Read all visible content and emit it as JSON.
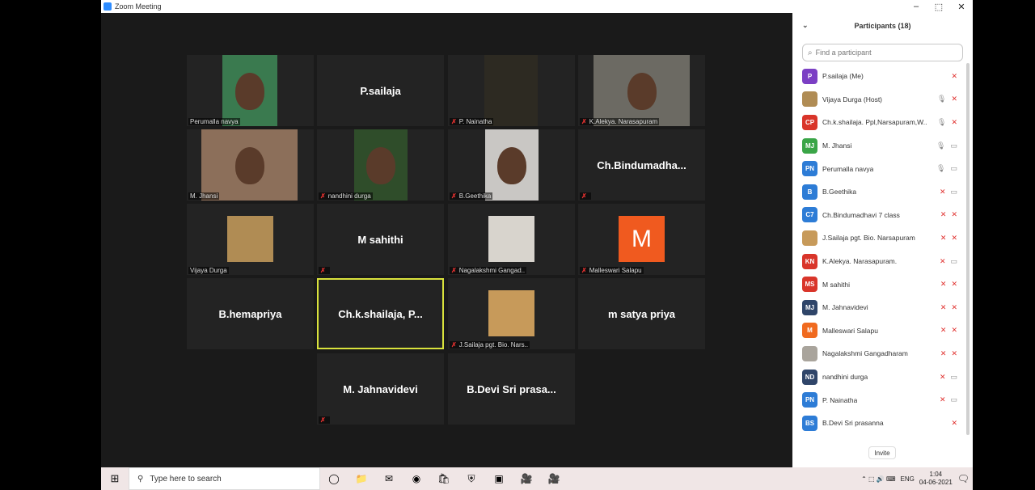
{
  "window": {
    "title": "Zoom Meeting",
    "controls": [
      "–",
      "⬚",
      "✕"
    ]
  },
  "tiles": [
    {
      "id": "t1",
      "label": "Perumalla navya",
      "mic_muted": false,
      "video": true,
      "video_color": "#3a7a4f",
      "name_shown": ""
    },
    {
      "id": "t2",
      "label": "",
      "mic_muted": false,
      "video": false,
      "name_shown": "P.sailaja"
    },
    {
      "id": "t3",
      "label": "P. Nainatha",
      "mic_muted": true,
      "video": true,
      "video_color": "#2d2a22",
      "name_shown": ""
    },
    {
      "id": "t4",
      "label": "K.Alekya. Narasapuram",
      "mic_muted": true,
      "video": true,
      "video_color": "#6c6a63",
      "name_shown": ""
    },
    {
      "id": "t5",
      "label": "M. Jhansi",
      "mic_muted": false,
      "video": true,
      "video_color": "#8c6f5a",
      "name_shown": ""
    },
    {
      "id": "t6",
      "label": "nandhini durga",
      "mic_muted": true,
      "video": true,
      "video_color": "#2f4d2a",
      "name_shown": ""
    },
    {
      "id": "t7",
      "label": "B.Geethika",
      "mic_muted": true,
      "video": true,
      "video_color": "#c9c7c4",
      "name_shown": ""
    },
    {
      "id": "t8",
      "label": "",
      "mic_muted": true,
      "video": false,
      "name_shown": "Ch.Bindumadha..."
    },
    {
      "id": "t9",
      "label": "Vijaya Durga",
      "mic_muted": false,
      "video": true,
      "video_color": "#b08c54",
      "name_shown": ""
    },
    {
      "id": "t10",
      "label": "",
      "mic_muted": true,
      "video": false,
      "name_shown": "M sahithi"
    },
    {
      "id": "t11",
      "label": "Nagalakshmi Gangad..",
      "mic_muted": true,
      "video": true,
      "video_color": "#d8d4cd",
      "name_shown": ""
    },
    {
      "id": "t12",
      "label": "Malleswari Salapu",
      "mic_muted": true,
      "video": false,
      "avatar_letter": "M",
      "name_shown": ""
    },
    {
      "id": "t13",
      "label": "",
      "mic_muted": false,
      "video": false,
      "name_shown": "B.hemapriya"
    },
    {
      "id": "t14",
      "label": "",
      "mic_muted": false,
      "video": false,
      "name_shown": "Ch.k.shailaja,  P...",
      "active": true
    },
    {
      "id": "t15",
      "label": "J.Sailaja pgt. Bio. Nars..",
      "mic_muted": true,
      "video": true,
      "video_color": "#c79a5a",
      "name_shown": ""
    },
    {
      "id": "t16",
      "label": "",
      "mic_muted": false,
      "video": false,
      "name_shown": "m satya priya"
    },
    {
      "id": "t17",
      "label": "",
      "mic_muted": true,
      "video": false,
      "name_shown": "M. Jahnavidevi"
    },
    {
      "id": "t18",
      "label": "",
      "mic_muted": false,
      "video": false,
      "name_shown": "B.Devi Sri   prasa..."
    }
  ],
  "sidebar": {
    "title": "Participants (18)",
    "search_placeholder": "Find a participant",
    "invite_label": "Invite",
    "participants": [
      {
        "initials": "P",
        "color": "#7b3fc4",
        "name": "P.sailaja (Me)",
        "mic": "",
        "cam": "✕",
        "cam_off": true
      },
      {
        "initials": "",
        "color": "#b08c54",
        "name": "Vijaya Durga (Host)",
        "mic": "🎙",
        "cam": "✕",
        "cam_off": true,
        "mic_muted": false
      },
      {
        "initials": "CP",
        "color": "#d9352a",
        "name": "Ch.k.shailaja. Ppl,Narsapuram,W...",
        "mic": "🎙",
        "cam": "✕",
        "cam_off": true,
        "mic_muted": false
      },
      {
        "initials": "MJ",
        "color": "#3aa547",
        "name": "M. Jhansi",
        "mic": "🎙",
        "cam": "▭",
        "cam_off": false,
        "mic_muted": false
      },
      {
        "initials": "PN",
        "color": "#2d7cd6",
        "name": "Perumalla navya",
        "mic": "🎙",
        "cam": "▭",
        "cam_off": false,
        "mic_muted": false
      },
      {
        "initials": "B",
        "color": "#2d7cd6",
        "name": "B.Geethika",
        "mic": "✕",
        "cam": "▭",
        "cam_off": false,
        "mic_muted": true
      },
      {
        "initials": "C7",
        "color": "#2d7cd6",
        "name": "Ch.Bindumadhavi 7 class",
        "mic": "✕",
        "cam": "✕",
        "cam_off": true,
        "mic_muted": true
      },
      {
        "initials": "",
        "color": "#c79a5a",
        "name": "J.Sailaja pgt. Bio. Narsapuram",
        "mic": "✕",
        "cam": "✕",
        "cam_off": true,
        "mic_muted": true
      },
      {
        "initials": "KN",
        "color": "#d9352a",
        "name": "K.Alekya. Narasapuram.",
        "mic": "✕",
        "cam": "▭",
        "cam_off": false,
        "mic_muted": true
      },
      {
        "initials": "MS",
        "color": "#d9352a",
        "name": "M sahithi",
        "mic": "✕",
        "cam": "✕",
        "cam_off": true,
        "mic_muted": true
      },
      {
        "initials": "MJ",
        "color": "#2f4569",
        "name": "M. Jahnavidevi",
        "mic": "✕",
        "cam": "✕",
        "cam_off": true,
        "mic_muted": true
      },
      {
        "initials": "M",
        "color": "#f06a1f",
        "name": "Malleswari Salapu",
        "mic": "✕",
        "cam": "✕",
        "cam_off": true,
        "mic_muted": true
      },
      {
        "initials": "",
        "color": "#a9a49c",
        "name": "Nagalakshmi Gangadharam",
        "mic": "✕",
        "cam": "✕",
        "cam_off": true,
        "mic_muted": true
      },
      {
        "initials": "ND",
        "color": "#2f4569",
        "name": "nandhini durga",
        "mic": "✕",
        "cam": "▭",
        "cam_off": false,
        "mic_muted": true
      },
      {
        "initials": "PN",
        "color": "#2d7cd6",
        "name": "P. Nainatha",
        "mic": "✕",
        "cam": "▭",
        "cam_off": false,
        "mic_muted": true
      },
      {
        "initials": "BS",
        "color": "#2d7cd6",
        "name": "B.Devi Sri  prasanna",
        "mic": "",
        "cam": "✕",
        "cam_off": true,
        "mic_muted": false
      }
    ]
  },
  "taskbar": {
    "search_placeholder": "Type here to search",
    "lang": "ENG",
    "time": "1:04",
    "date": "04-06-2021",
    "icons": [
      "task-view-icon",
      "folder-icon",
      "mail-icon",
      "edge-icon",
      "store-icon",
      "vpn-icon",
      "app-icon",
      "zoom-icon",
      "zoom-icon"
    ]
  },
  "colors": {
    "mic_muted": "#e0312f",
    "active_border": "#d9e23c",
    "zoom_blue": "#2d8cff"
  }
}
